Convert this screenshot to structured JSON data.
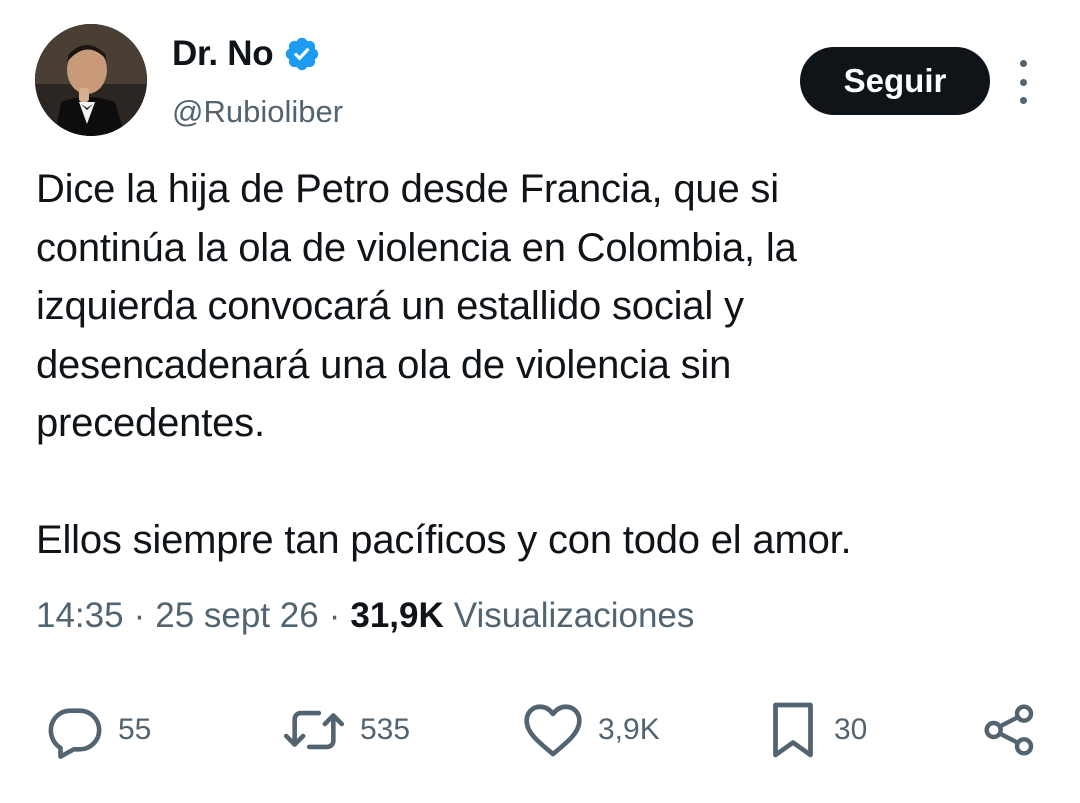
{
  "author": {
    "display_name": "Dr. No",
    "handle": "@Rubioliber",
    "verified": true,
    "avatar_icon": "profile-avatar"
  },
  "follow_button": {
    "label": "Seguir"
  },
  "more_menu": {
    "icon": "more-vertical-icon"
  },
  "tweet": {
    "text": "Dice la hija de Petro desde Francia, que si\ncontinúa la ola de violencia en Colombia, la\nizquierda convocará un estallido social y\ndesencadenará una ola de violencia sin\nprecedentes.\n\nEllos siempre tan pacíficos y con todo el amor."
  },
  "meta": {
    "time": "14:35",
    "separator": "·",
    "date": "25 sept 26",
    "views_count": "31,9K",
    "views_label": "Visualizaciones"
  },
  "actions": {
    "replies": "55",
    "retweets": "535",
    "likes": "3,9K",
    "bookmarks": "30"
  },
  "colors": {
    "text": "#0f1419",
    "secondary": "#536471",
    "verified": "#1d9bf0",
    "button_bg": "#0f1419"
  }
}
